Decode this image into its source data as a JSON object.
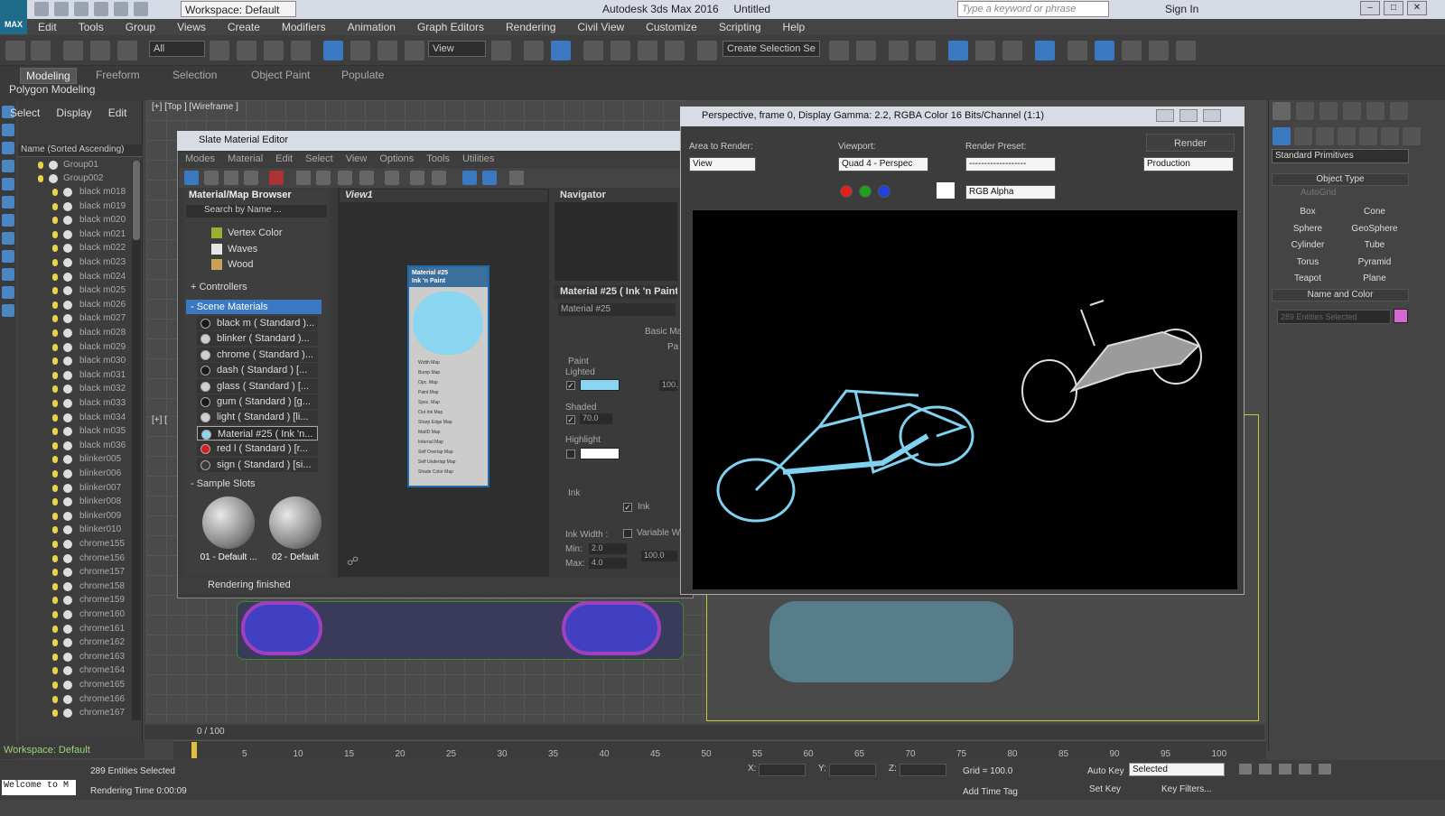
{
  "app": {
    "title": "Autodesk 3ds Max 2016",
    "doc": "Untitled",
    "workspace": "Workspace: Default",
    "search_placeholder": "Type a keyword or phrase",
    "sign_in": "Sign In",
    "logo": "MAX"
  },
  "menu": [
    "Edit",
    "Tools",
    "Group",
    "Views",
    "Create",
    "Modifiers",
    "Animation",
    "Graph Editors",
    "Rendering",
    "Civil View",
    "Customize",
    "Scripting",
    "Help"
  ],
  "toolbar": {
    "filter": "All",
    "view": "View",
    "selection_set": "Create Selection Se"
  },
  "ribbon": {
    "tabs": [
      "Modeling",
      "Freeform",
      "Selection",
      "Object Paint",
      "Populate"
    ],
    "sub": "Polygon Modeling"
  },
  "explorer": {
    "menu": [
      "Select",
      "Display",
      "Edit"
    ],
    "header": "Name (Sorted Ascending)",
    "groups": [
      "Group01",
      "Group002"
    ],
    "items": [
      "black m018",
      "black m019",
      "black m020",
      "black m021",
      "black m022",
      "black m023",
      "black m024",
      "black m025",
      "black m026",
      "black m027",
      "black m028",
      "black m029",
      "black m030",
      "black m031",
      "black m032",
      "black m033",
      "black m034",
      "black m035",
      "black m036",
      "blinker005",
      "blinker006",
      "blinker007",
      "blinker008",
      "blinker009",
      "blinker010",
      "chrome155",
      "chrome156",
      "chrome157",
      "chrome158",
      "chrome159",
      "chrome160",
      "chrome161",
      "chrome162",
      "chrome163",
      "chrome164",
      "chrome165",
      "chrome166",
      "chrome167"
    ],
    "footer": "Workspace: Default"
  },
  "viewports": {
    "top": "[+] [Top ] [Wireframe ]",
    "persp": "[+] ["
  },
  "cmd": {
    "primitive_type": "Standard Primitives",
    "object_type": "Object Type",
    "autogrid": "AutoGrid",
    "buttons": [
      "Box",
      "Cone",
      "Sphere",
      "GeoSphere",
      "Cylinder",
      "Tube",
      "Torus",
      "Pyramid",
      "Teapot",
      "Plane"
    ],
    "name_color": "Name and Color",
    "name_value": "289 Entities Selected",
    "color": "#d36ad3"
  },
  "slate": {
    "title": "Slate Material Editor",
    "menu": [
      "Modes",
      "Material",
      "Edit",
      "Select",
      "View",
      "Options",
      "Tools",
      "Utilities"
    ],
    "browser_title": "Material/Map Browser",
    "search": "Search by Name ...",
    "maps": [
      {
        "label": "Vertex Color",
        "color": "#9aae3a"
      },
      {
        "label": "Waves",
        "color": "#e6e6e6"
      },
      {
        "label": "Wood",
        "color": "#c9a25a"
      }
    ],
    "controllers": "+ Controllers",
    "scene_materials": "- Scene Materials",
    "materials": [
      {
        "label": "black m  ( Standard )...",
        "ball": "#1a1a1a"
      },
      {
        "label": "blinker  ( Standard )...",
        "ball": "#cfcfcf"
      },
      {
        "label": "chrome  ( Standard )...",
        "ball": "#cfcfcf"
      },
      {
        "label": "dash  ( Standard ) [...",
        "ball": "#1a1a1a"
      },
      {
        "label": "glass  ( Standard ) [...",
        "ball": "#cfcfcf"
      },
      {
        "label": "gum  ( Standard ) [g...",
        "ball": "#1a1a1a"
      },
      {
        "label": "light  ( Standard ) [li...",
        "ball": "#cfcfcf"
      },
      {
        "label": "Material #25  ( Ink 'n...",
        "ball": "#8ad6f0"
      },
      {
        "label": "red l  ( Standard ) [r...",
        "ball": "#d62020"
      },
      {
        "label": "sign  ( Standard ) [si...",
        "ball": "#3a3a3a"
      }
    ],
    "sample_slots": "- Sample Slots",
    "slots": [
      "01 - Default ...",
      "02 - Default"
    ],
    "view_tab": "View1",
    "navigator": "Navigator",
    "node_title": "Material #25\nInk 'n Paint",
    "node_color": "#8ad6f0",
    "node_slots": [
      "Width Map",
      "Bump Map",
      "Opc. Map",
      "Paint Map",
      "Spec. Map",
      "Out Ink Map",
      "Sharp Edge Map",
      "MatID Map",
      "Internal Map",
      "Self Overlap Map",
      "Self Underlap Map",
      "Shade Color Map"
    ],
    "param_title": "Material #25  ( Ink 'n Paint )",
    "param_name": "Material #25",
    "basic": "Basic Ma",
    "pa": "Pa",
    "paint": "Paint",
    "lighted": "Lighted",
    "lighted_color": "#8ad6f0",
    "lighted_val": "100.",
    "shaded": "Shaded",
    "shaded_val": "70.0",
    "highlight": "Highlight",
    "ink": "Ink",
    "ink_chk": "Ink",
    "ink_width": "Ink Width :",
    "variable": "Variable W",
    "min_lbl": "Min:",
    "min_val": "2.0",
    "max_lbl": "Max:",
    "max_val": "4.0",
    "right_val": "100.0",
    "status": "Rendering finished"
  },
  "render": {
    "title": "Perspective, frame 0, Display Gamma: 2.2, RGBA Color 16 Bits/Channel (1:1)",
    "area_lbl": "Area to Render:",
    "area": "View",
    "viewport_lbl": "Viewport:",
    "viewport": "Quad 4 - Perspec",
    "preset_lbl": "Render Preset:",
    "preset": "-------------------",
    "render_btn": "Render",
    "production": "Production",
    "channel": "RGB Alpha"
  },
  "time": {
    "frame": "0 / 100",
    "ticks": [
      "5",
      "10",
      "15",
      "20",
      "25",
      "30",
      "35",
      "40",
      "45",
      "50",
      "55",
      "60",
      "65",
      "70",
      "75",
      "80",
      "85",
      "90",
      "95",
      "100"
    ]
  },
  "status": {
    "selection": "289 Entities Selected",
    "render_time": "Rendering Time  0:00:09",
    "welcome": "Welcome to M",
    "x": "X:",
    "y": "Y:",
    "z": "Z:",
    "grid": "Grid = 100.0",
    "add_time_tag": "Add Time Tag",
    "auto_key": "Auto Key",
    "set_key": "Set Key",
    "selected": "Selected",
    "key_filters": "Key Filters..."
  }
}
